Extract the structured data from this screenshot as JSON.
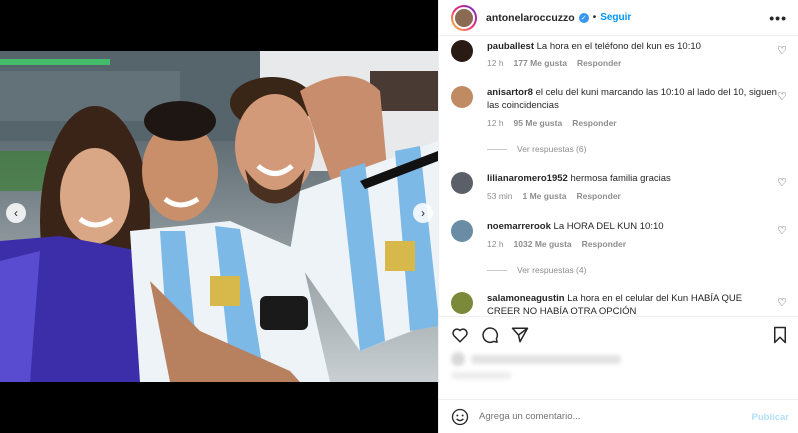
{
  "header": {
    "username": "antonelaroccuzzo",
    "separator": "•",
    "follow_label": "Seguir",
    "more_label": "•••"
  },
  "comments": [
    {
      "user": "pauballest",
      "text": "La hora en el teléfono del kun es 10:10",
      "time": "12 h",
      "likes": "177 Me gusta",
      "reply": "Responder"
    },
    {
      "user": "anisartor8",
      "text": "el celu del kuni marcando las 10:10 al lado del 10, siguen las coincidencias",
      "time": "12 h",
      "likes": "95 Me gusta",
      "reply": "Responder",
      "view_replies": "Ver respuestas (6)"
    },
    {
      "user": "lilianaromero1952",
      "text": "hermosa familia gracias",
      "time": "53 min",
      "likes": "1 Me gusta",
      "reply": "Responder"
    },
    {
      "user": "noemarrerook",
      "text": "La HORA DEL KUN 10:10",
      "time": "12 h",
      "likes": "1032 Me gusta",
      "reply": "Responder",
      "view_replies": "Ver respuestas (4)"
    },
    {
      "user": "salamoneagustin",
      "text": "La hora en el celular del Kun HABÍA QUE CREER NO HABÍA OTRA OPCIÓN"
    }
  ],
  "composer": {
    "placeholder": "Agrega un comentario...",
    "post_label": "Publicar"
  },
  "colors": {
    "accent": "#0095f6",
    "verified": "#3897f0",
    "muted": "#8e8e8e"
  },
  "icons": [
    "verified-badge-icon",
    "heart-icon",
    "comment-icon",
    "share-icon",
    "bookmark-icon",
    "emoji-icon",
    "chevron-left-icon",
    "chevron-right-icon"
  ]
}
